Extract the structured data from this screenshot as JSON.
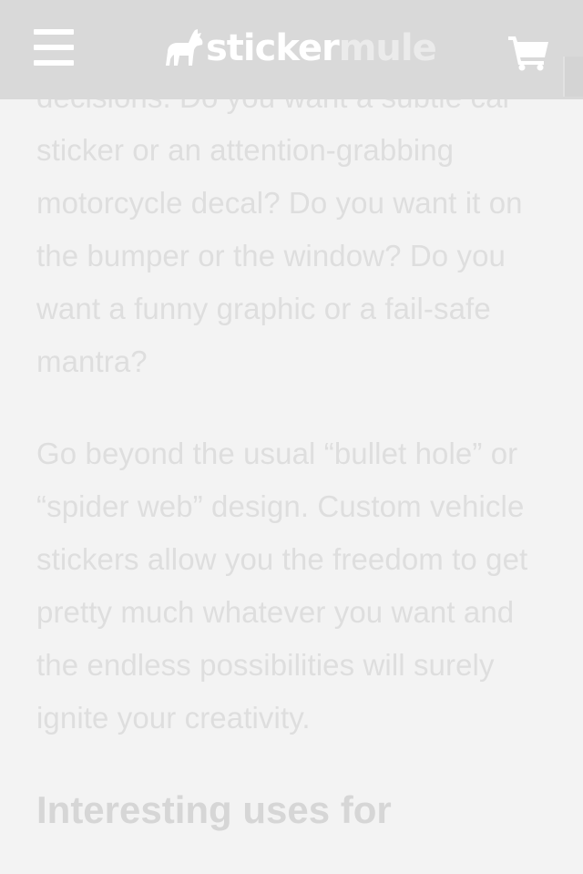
{
  "header": {
    "menu_icon": "hamburger-menu-icon",
    "brand": {
      "part1": "sticker",
      "part2": "mule",
      "logo_icon": "mule-logo-icon"
    },
    "cart_icon": "shopping-cart-icon",
    "background": "#d9d9d9"
  },
  "article": {
    "text_color": "#dedede",
    "page_background": "#f3f3f3",
    "paragraphs": [
      "decisions. Do you want a subtle car sticker or an attention-grabbing motorcycle decal? Do you want it on the bumper or the window? Do you want a funny graphic or a fail-safe mantra?",
      "Go beyond the usual “bullet hole” or “spider web” design. Custom vehicle stickers allow you the freedom to get pretty much whatever you want and the endless possibilities will surely ignite your creativity."
    ],
    "heading": "Interesting uses for"
  }
}
